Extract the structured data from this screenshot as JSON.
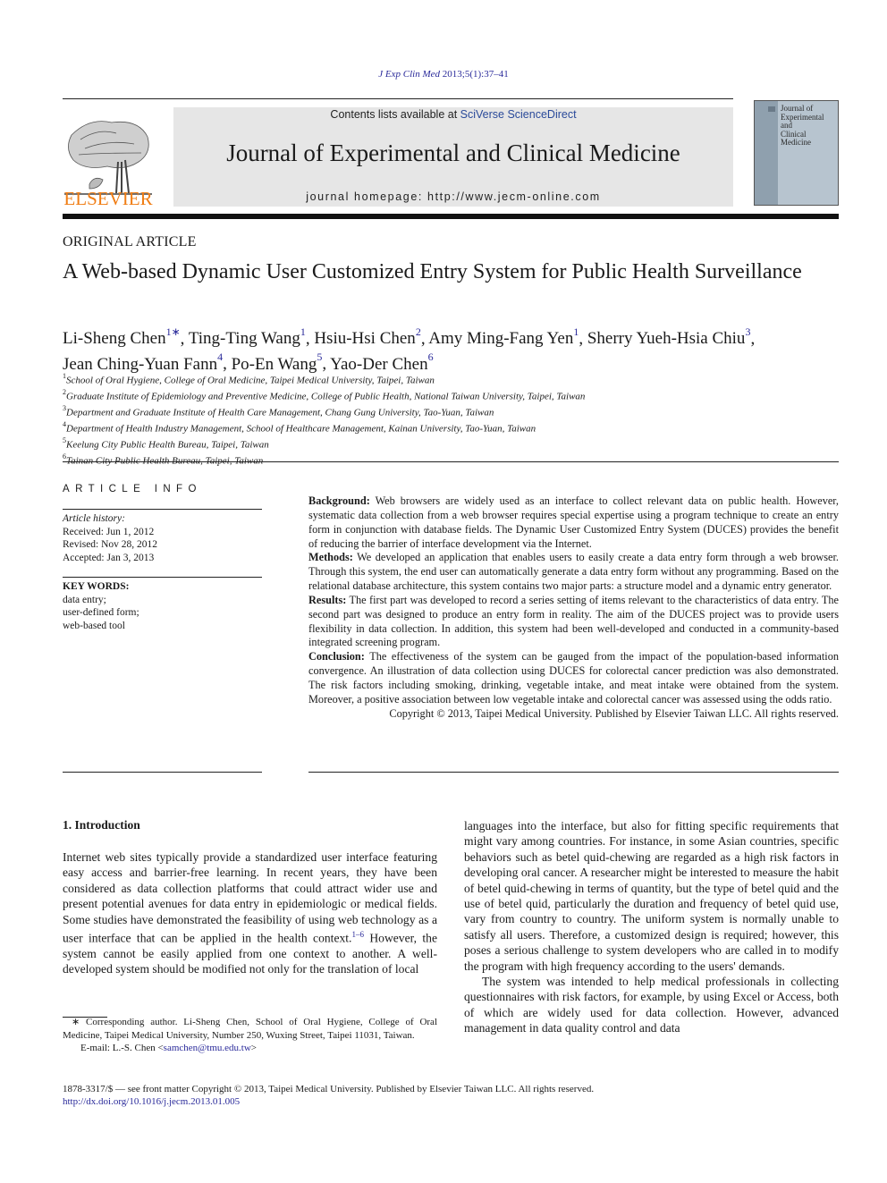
{
  "header": {
    "citation_journal": "J Exp Clin Med",
    "citation_rest": "2013;5(1):37–41",
    "publisher_wordmark": "ELSEVIER",
    "contents_prefix": "Contents lists available at ",
    "contents_link": "SciVerse ScienceDirect",
    "journal_title": "Journal of Experimental and Clinical Medicine",
    "homepage": "journal homepage: http://www.jecm-online.com",
    "cover_title_lines": [
      "Journal of",
      "Experimental",
      "and",
      "Clinical",
      "Medicine"
    ]
  },
  "article": {
    "section": "ORIGINAL ARTICLE",
    "title": "A Web-based Dynamic User Customized Entry System for Public Health Surveillance",
    "authors": [
      {
        "name": "Li-Sheng Chen",
        "sup": "1∗"
      },
      {
        "name": "Ting-Ting Wang",
        "sup": "1"
      },
      {
        "name": "Hsiu-Hsi Chen",
        "sup": "2"
      },
      {
        "name": "Amy Ming-Fang Yen",
        "sup": "1"
      },
      {
        "name": "Sherry Yueh-Hsia Chiu",
        "sup": "3"
      },
      {
        "name": "Jean Ching-Yuan Fann",
        "sup": "4"
      },
      {
        "name": "Po-En Wang",
        "sup": "5"
      },
      {
        "name": "Yao-Der Chen",
        "sup": "6"
      }
    ],
    "affiliations": [
      {
        "num": "1",
        "text": "School of Oral Hygiene, College of Oral Medicine, Taipei Medical University, Taipei, Taiwan"
      },
      {
        "num": "2",
        "text": "Graduate Institute of Epidemiology and Preventive Medicine, College of Public Health, National Taiwan University, Taipei, Taiwan"
      },
      {
        "num": "3",
        "text": "Department and Graduate Institute of Health Care Management, Chang Gung University, Tao-Yuan, Taiwan"
      },
      {
        "num": "4",
        "text": "Department of Health Industry Management, School of Healthcare Management, Kainan University, Tao-Yuan, Taiwan"
      },
      {
        "num": "5",
        "text": "Keelung City Public Health Bureau, Taipei, Taiwan"
      },
      {
        "num": "6",
        "text": "Tainan City Public Health Bureau, Taipei, Taiwan"
      }
    ]
  },
  "article_info": {
    "heading": "ARTICLE INFO",
    "history_label": "Article history:",
    "received": "Received: Jun 1, 2012",
    "revised": "Revised: Nov 28, 2012",
    "accepted": "Accepted: Jan 3, 2013",
    "keywords_label": "KEY WORDS:",
    "keywords": [
      "data entry;",
      "user-defined form;",
      "web-based tool"
    ]
  },
  "abstract": {
    "sections": [
      {
        "label": "Background:",
        "text": "Web browsers are widely used as an interface to collect relevant data on public health. However, systematic data collection from a web browser requires special expertise using a program technique to create an entry form in conjunction with database fields. The Dynamic User Customized Entry System (DUCES) provides the benefit of reducing the barrier of interface development via the Internet."
      },
      {
        "label": "Methods:",
        "text": "We developed an application that enables users to easily create a data entry form through a web browser. Through this system, the end user can automatically generate a data entry form without any programming. Based on the relational database architecture, this system contains two major parts: a structure model and a dynamic entry generator."
      },
      {
        "label": "Results:",
        "text": "The first part was developed to record a series setting of items relevant to the characteristics of data entry. The second part was designed to produce an entry form in reality. The aim of the DUCES project was to provide users flexibility in data collection. In addition, this system had been well-developed and conducted in a community-based integrated screening program."
      },
      {
        "label": "Conclusion:",
        "text": "The effectiveness of the system can be gauged from the impact of the population-based information convergence. An illustration of data collection using DUCES for colorectal cancer prediction was also demonstrated. The risk factors including smoking, drinking, vegetable intake, and meat intake were obtained from the system. Moreover, a positive association between low vegetable intake and colorectal cancer was assessed using the odds ratio."
      }
    ],
    "copyright": "Copyright © 2013, Taipei Medical University. Published by Elsevier Taiwan LLC. All rights reserved."
  },
  "body": {
    "intro_heading": "1.  Introduction",
    "col1_part1": "Internet web sites typically provide a standardized user interface featuring easy access and barrier-free learning. In recent years, they have been considered as data collection platforms that could attract wider use and present potential avenues for data entry in epidemiologic or medical fields. Some studies have demonstrated the feasibility of using web technology as a user interface that can be applied in the health context.",
    "col1_ref": "1–6",
    "col1_part2": " However, the system cannot be easily applied from one context to another. A well-developed system should be modified not only for the translation of local",
    "col2_para1": "languages into the interface, but also for fitting specific requirements that might vary among countries. For instance, in some Asian countries, specific behaviors such as betel quid-chewing are regarded as a high risk factors in developing oral cancer. A researcher might be interested to measure the habit of betel quid-chewing in terms of quantity, but the type of betel quid and the use of betel quid, particularly the duration and frequency of betel quid use, vary from country to country. The uniform system is normally unable to satisfy all users. Therefore, a customized design is required; however, this poses a serious challenge to system developers who are called in to modify the program with high frequency according to the users' demands.",
    "col2_para2": "The system was intended to help medical professionals in collecting questionnaires with risk factors, for example, by using Excel or Access, both of which are widely used for data collection. However, advanced management in data quality control and data"
  },
  "footnote": {
    "corresponding": "∗ Corresponding author. Li-Sheng Chen, School of Oral Hygiene, College of Oral Medicine, Taipei Medical University, Number 250, Wuxing Street, Taipei 11031, Taiwan.",
    "email_prefix": "E-mail: L.-S. Chen <",
    "email": "samchen@tmu.edu.tw",
    "email_suffix": ">"
  },
  "bottom": {
    "issn_line": "1878-3317/$ — see front matter Copyright © 2013, Taipei Medical University. Published by Elsevier Taiwan LLC. All rights reserved.",
    "doi": "http://dx.doi.org/10.1016/j.jecm.2013.01.005"
  },
  "colors": {
    "link": "#2a2a9a",
    "elsevier_orange": "#f07d14",
    "banner_gray": "#e6e6e6"
  }
}
